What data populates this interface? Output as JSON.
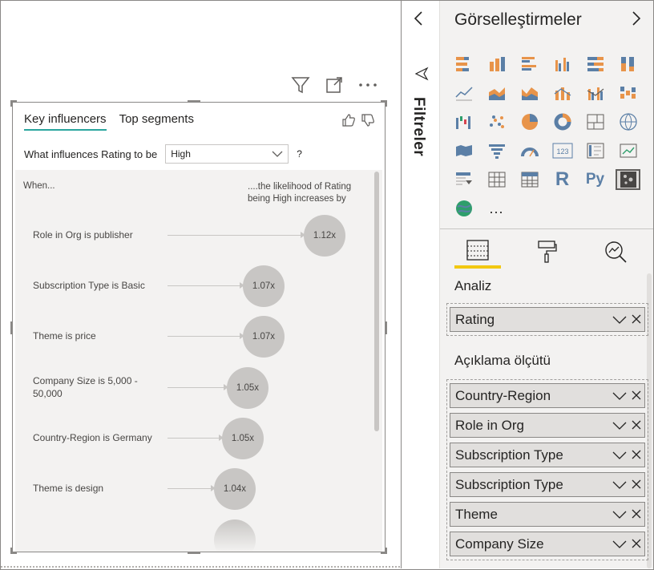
{
  "visual": {
    "tabs": [
      {
        "label": "Key influencers"
      },
      {
        "label": "Top segments"
      }
    ],
    "question_prefix": "What influences Rating to be",
    "dropdown_value": "High",
    "help": "?",
    "col_when": "When...",
    "col_likely": "....the likelihood of Rating being High increases by",
    "influencers": [
      {
        "label": "Role in Org is publisher",
        "value": "1.12x"
      },
      {
        "label": "Subscription Type is Basic",
        "value": "1.07x"
      },
      {
        "label": "Theme is price",
        "value": "1.07x"
      },
      {
        "label": "Company Size is 5,000 - 50,000",
        "value": "1.05x"
      },
      {
        "label": "Country-Region is Germany",
        "value": "1.05x"
      },
      {
        "label": "Theme is design",
        "value": "1.04x"
      }
    ]
  },
  "filters": {
    "label": "Filtreler"
  },
  "viz_pane": {
    "title": "Görselleştirmeler",
    "analyze_label": "Analiz",
    "analyze_fields": [
      {
        "label": "Rating"
      }
    ],
    "explain_label": "Açıklama ölçütü",
    "explain_fields": [
      {
        "label": "Country-Region"
      },
      {
        "label": "Role in Org"
      },
      {
        "label": "Subscription Type"
      },
      {
        "label": "Subscription Type"
      },
      {
        "label": "Theme"
      },
      {
        "label": "Company Size"
      }
    ],
    "r_label": "R",
    "py_label": "Py",
    "more": "..."
  },
  "colors": {
    "accent_tab": "#2aa59e",
    "active_pane_tab": "#f2c811",
    "bubble": "#c8c6c4"
  }
}
